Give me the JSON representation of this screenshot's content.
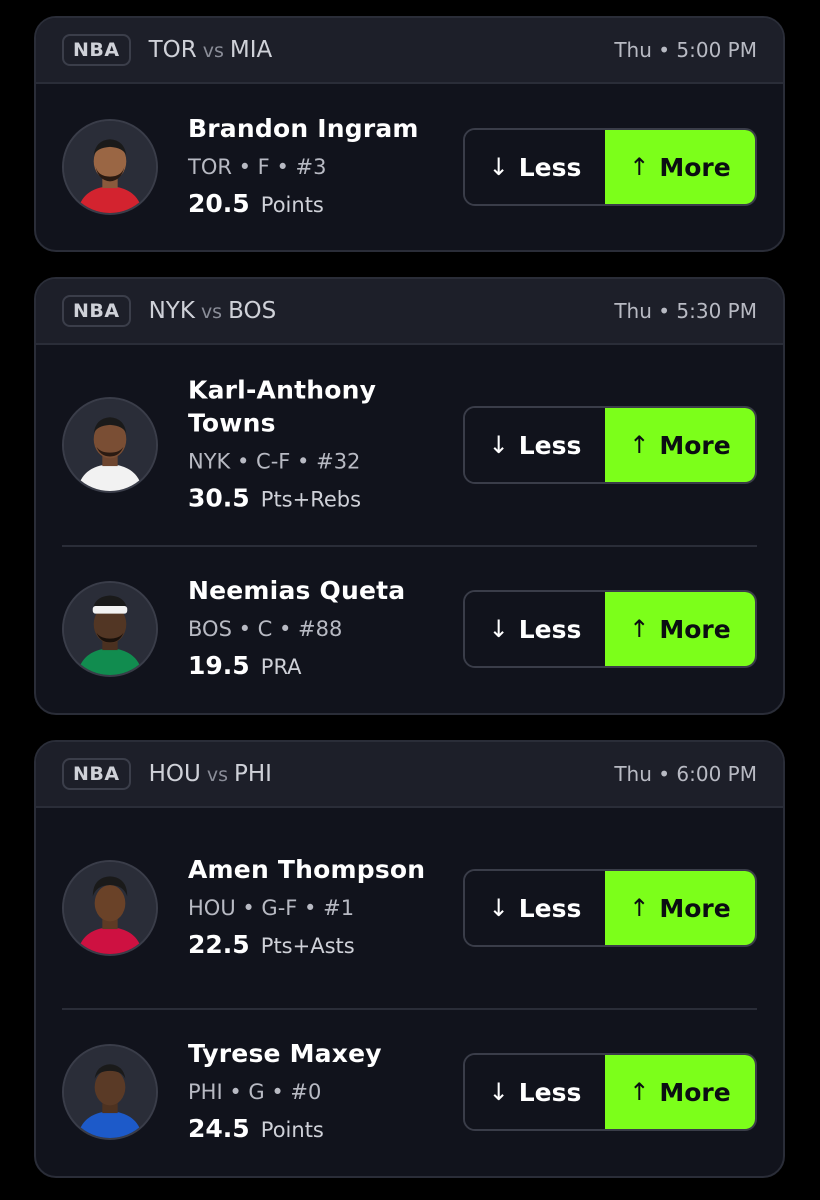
{
  "colors": {
    "accent": "#7cff1a",
    "card_bg": "#11131c",
    "header_bg": "#1d1f29",
    "border": "#2a2d38"
  },
  "pick_labels": {
    "less": "Less",
    "more": "More",
    "less_icon": "arrow-down-icon",
    "more_icon": "arrow-up-icon"
  },
  "games": [
    {
      "league": "NBA",
      "away": "TOR",
      "vs": "vs",
      "home": "MIA",
      "time": "Thu • 5:00 PM",
      "players": [
        {
          "name": "Brandon Ingram",
          "meta": "TOR • F • #3",
          "line": "20.5",
          "stat": "Points",
          "jersey_color": "#d3232f",
          "avatar_icon": "player-headshot"
        }
      ]
    },
    {
      "league": "NBA",
      "away": "NYK",
      "vs": "vs",
      "home": "BOS",
      "time": "Thu • 5:30 PM",
      "players": [
        {
          "name": "Karl-Anthony Towns",
          "meta": "NYK • C-F • #32",
          "line": "30.5",
          "stat": "Pts+Rebs",
          "jersey_color": "#f2f2f2",
          "avatar_icon": "player-headshot"
        },
        {
          "name": "Neemias Queta",
          "meta": "BOS • C • #88",
          "line": "19.5",
          "stat": "PRA",
          "jersey_color": "#118c4f",
          "avatar_icon": "player-headshot"
        }
      ]
    },
    {
      "league": "NBA",
      "away": "HOU",
      "vs": "vs",
      "home": "PHI",
      "time": "Thu • 6:00 PM",
      "players": [
        {
          "name": "Amen Thompson",
          "meta": "HOU • G-F • #1",
          "line": "22.5",
          "stat": "Pts+Asts",
          "jersey_color": "#ce1141",
          "avatar_icon": "player-headshot"
        },
        {
          "name": "Tyrese Maxey",
          "meta": "PHI • G • #0",
          "line": "24.5",
          "stat": "Points",
          "jersey_color": "#1d5ac9",
          "avatar_icon": "player-headshot"
        }
      ]
    }
  ]
}
